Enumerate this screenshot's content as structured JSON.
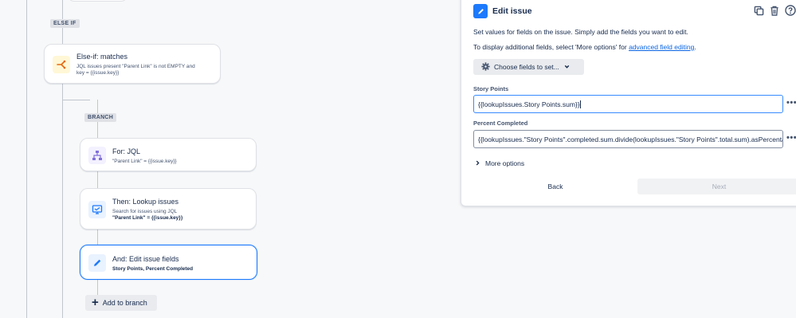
{
  "flow": {
    "else_if_pill": "ELSE IF",
    "branch_pill": "BRANCH",
    "else_if_node": {
      "title": "Else-if: matches",
      "line1": "JQL issues present \"Parent Link\" is not EMPTY and",
      "line2": "key = {{issue.key}}",
      "icon": "branch-split-icon",
      "icon_bg": "#fff7d6",
      "icon_color": "#e56910"
    },
    "for_node": {
      "title": "For: JQL",
      "line1": "\"Parent Link\" = {{issue.key}}",
      "icon": "hierarchy-icon",
      "icon_bg": "#f3f0ff",
      "icon_color": "#8270db"
    },
    "lookup_node": {
      "title": "Then: Lookup issues",
      "line1": "Search for issues using JQL",
      "line2": "\"Parent Link\" = {{issue.key}}",
      "icon": "monitor-search-icon",
      "icon_bg": "#e9f2ff",
      "icon_color": "#1d7afc"
    },
    "edit_node": {
      "title": "And: Edit issue fields",
      "line1": "Story Points, Percent Completed",
      "icon": "pencil-icon",
      "icon_bg": "#e9f2ff",
      "icon_color": "#1d7afc"
    },
    "add_to_branch_label": "Add to branch"
  },
  "panel": {
    "title": "Edit issue",
    "description": "Set values for fields on the issue. Simply add the fields you want to edit.",
    "advanced_prefix": "To display additional fields, select 'More options' for ",
    "advanced_link": "advanced field editing",
    "advanced_suffix": ".",
    "choose_fields_label": "Choose fields to set...",
    "fields": [
      {
        "label": "Story Points",
        "value": "{{lookupIssues.Story Points.sum}}"
      },
      {
        "label": "Percent Completed",
        "value": "{{lookupIssues.\"Story Points\".completed.sum.divide(lookupIssues.\"Story Points\".total.sum).asPercentage}}"
      }
    ],
    "more_dots": "•••",
    "more_options_label": "More options",
    "back_label": "Back",
    "next_label": "Next",
    "accent": "#1d7afc",
    "link_color": "#0c66e4"
  }
}
